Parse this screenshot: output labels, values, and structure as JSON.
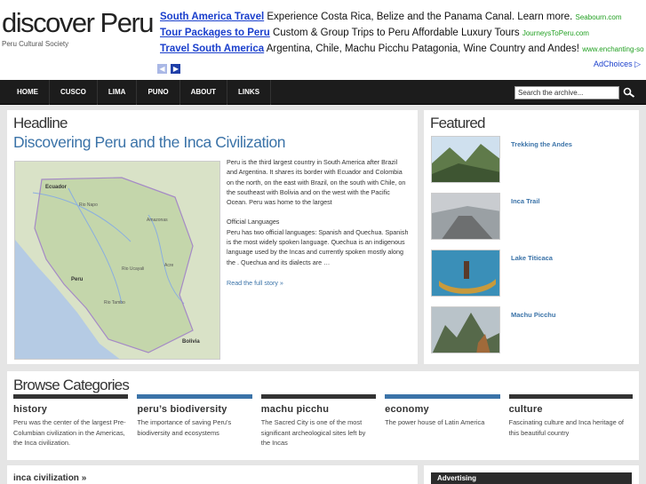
{
  "site": {
    "logo": "discover Peru",
    "tagline": "Peru Cultural Society"
  },
  "ads": [
    {
      "title": "South America Travel",
      "text": "Experience Costa Rica, Belize and the Panama Canal. Learn more.",
      "url": "Seabourn.com"
    },
    {
      "title": "Tour Packages to Peru",
      "text": "Custom & Group Trips to Peru Affordable Luxury Tours",
      "url": "JourneysToPeru.com"
    },
    {
      "title": "Travel South America",
      "text": "Argentina, Chile, Machu Picchu Patagonia, Wine Country and Andes!",
      "url": "www.enchanting-southame..."
    }
  ],
  "ad_controls": {
    "prev": "◀",
    "next": "▶",
    "adchoices": "AdChoices ▷"
  },
  "nav": {
    "items": [
      "HOME",
      "CUSCO",
      "LIMA",
      "PUNO",
      "ABOUT",
      "LINKS"
    ],
    "search_placeholder": "Search the archive..."
  },
  "headline": {
    "section_title": "Headline",
    "article_title": "Discovering Peru and the Inca Civilization",
    "para1": "Peru  is the third largest country in South America after Brazil and Argentina. It shares its border with Ecuador and Colombia on the north, on the east with Brazil, on the south with Chile, on the southeast with Bolivia and on the west with the Pacific Ocean. Peru was home to the largest",
    "para2": "Official Languages\nPeru has two official languages: Spanish and Quechua. Spanish is the most widely spoken language. Quechua is an indigenous language used by the Incas and currently spoken mostly along the . Quechua and its dialects are …",
    "read_more": "Read the full story »",
    "map_labels": [
      "Ecuador",
      "Peru",
      "Bolivia",
      "Rio Napo",
      "Amazonas",
      "Rio Ucayali",
      "Rio Tambo",
      "Acre"
    ]
  },
  "featured": {
    "section_title": "Featured",
    "items": [
      {
        "label": "Trekking the Andes",
        "icon": "mountain-trek-photo"
      },
      {
        "label": "Inca Trail",
        "icon": "stone-trail-photo"
      },
      {
        "label": "Lake Titicaca",
        "icon": "reed-boat-photo"
      },
      {
        "label": "Machu Picchu",
        "icon": "peaks-photo"
      }
    ]
  },
  "categories": {
    "section_title": "Browse Categories",
    "items": [
      {
        "name": "history",
        "desc": "Peru was the center of the largest Pre-Columbian civilization in the Americas, the Inca civilization.",
        "color": "#333333"
      },
      {
        "name": "peru’s biodiversity",
        "desc": "The importance of saving Peru's biodiversity and ecosystems",
        "color": "#3b73a8"
      },
      {
        "name": "machu picchu",
        "desc": "The Sacred City is one of the most significant archeological sites left by the Incas",
        "color": "#333333"
      },
      {
        "name": "economy",
        "desc": "The power house of Latin America",
        "color": "#3b73a8"
      },
      {
        "name": "culture",
        "desc": "Fascinating culture and Inca heritage of this beautiful country",
        "color": "#333333"
      }
    ]
  },
  "bottom": {
    "left_title": "inca civilization »",
    "right_title": "Advertising"
  }
}
